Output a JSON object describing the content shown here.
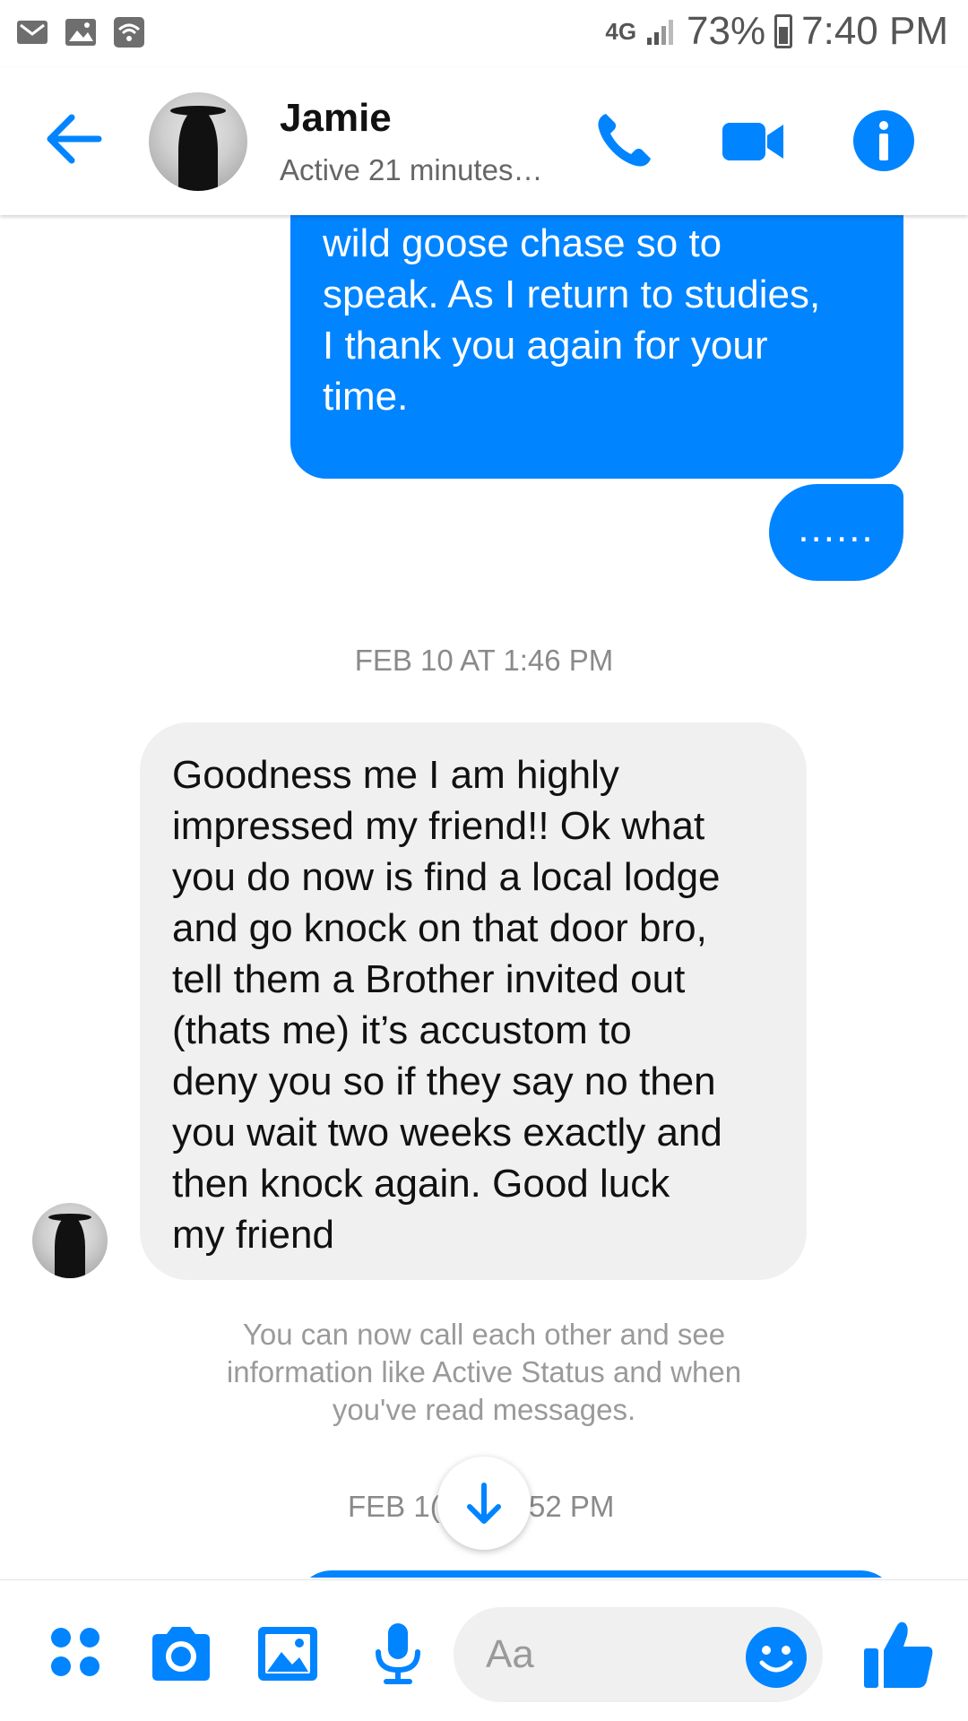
{
  "status_bar": {
    "network": "4G",
    "battery_pct": "73%",
    "time": "7:40 PM",
    "left_icons": [
      "gmail-icon",
      "image-icon",
      "wifi-icon"
    ]
  },
  "header": {
    "contact_name": "Jamie",
    "contact_status": "Active 21 minutes…",
    "accent_color": "#0084ff"
  },
  "messages": {
    "outgoing_1": "I desire my time not to be a\nwild goose chase so to\nspeak. As I return to studies,\nI thank you again for your\ntime.",
    "outgoing_2": "......",
    "timestamp_1": "FEB 10 AT 1:46 PM",
    "incoming_1": "Goodness me I am highly\nimpressed my friend!! Ok what\nyou do now is find a local lodge\nand go knock on that door bro,\ntell them a Brother invited out\n(thats me) it’s accustom to\ndeny you so if they say no then\nyou wait two weeks exactly and\nthen knock again. Good luck\nmy friend",
    "notice": "You can now call each other and see\ninformation like Active Status and when\nyou've read messages.",
    "timestamp_2_left": "FEB 1(",
    "timestamp_2_right": "52 PM"
  },
  "composer": {
    "placeholder": "Aa"
  }
}
